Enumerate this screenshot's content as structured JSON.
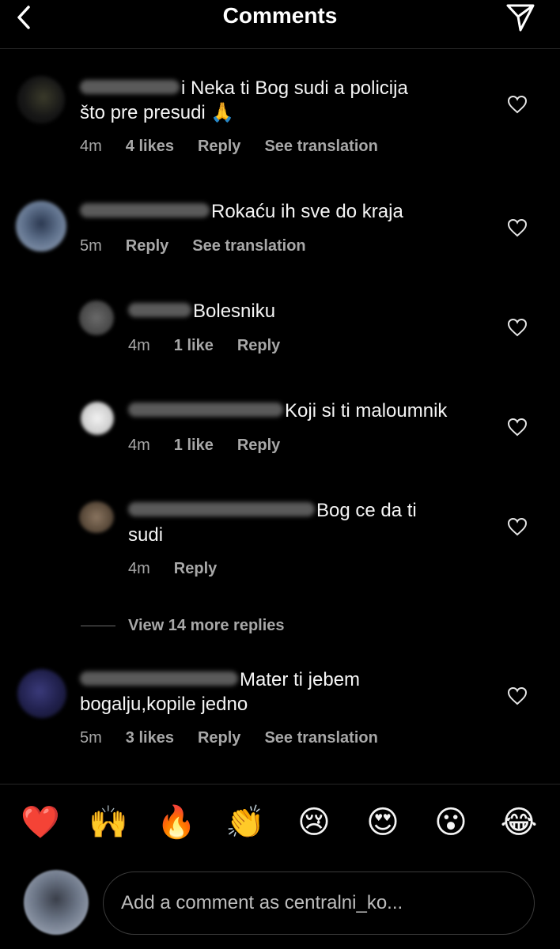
{
  "header": {
    "title": "Comments",
    "back_icon": "chevron-left-icon",
    "send_icon": "paper-plane-icon"
  },
  "comments": [
    {
      "text": "i Neka ti Bog sudi a policija što pre presudi 🙏",
      "line1": "i Neka ti Bog sudi a policija",
      "line2": "što pre presudi 🙏",
      "time": "4m",
      "likes": "4 likes",
      "reply": "Reply",
      "translation": "See translation"
    },
    {
      "text": "Rokaću ih sve do kraja",
      "time": "5m",
      "reply": "Reply",
      "translation": "See translation"
    },
    {
      "text": "Bolesniku",
      "time": "4m",
      "likes": "1 like",
      "reply": "Reply"
    },
    {
      "text": "Koji si ti maloumnik",
      "time": "4m",
      "likes": "1 like",
      "reply": "Reply"
    },
    {
      "text": "Bog ce da ti sudi",
      "line1": "Bog ce da ti",
      "line2": "sudi",
      "time": "4m",
      "reply": "Reply"
    },
    {
      "text": "Mater ti jebem bogalju,kopile jedno",
      "line1": "Mater ti jebem",
      "line2": "bogalju,kopile jedno",
      "time": "5m",
      "likes": "3 likes",
      "reply": "Reply",
      "translation": "See translation"
    }
  ],
  "view_more_replies": "View 14 more replies",
  "reactions": [
    "❤️",
    "🙌",
    "🔥",
    "👏",
    "😢",
    "😍",
    "😮",
    "😂"
  ],
  "composer": {
    "placeholder": "Add a comment as centralni_ko..."
  },
  "colors": {
    "background": "#000000",
    "text": "#f5f5f5",
    "secondary": "#a8a8a8",
    "divider": "#262626"
  }
}
